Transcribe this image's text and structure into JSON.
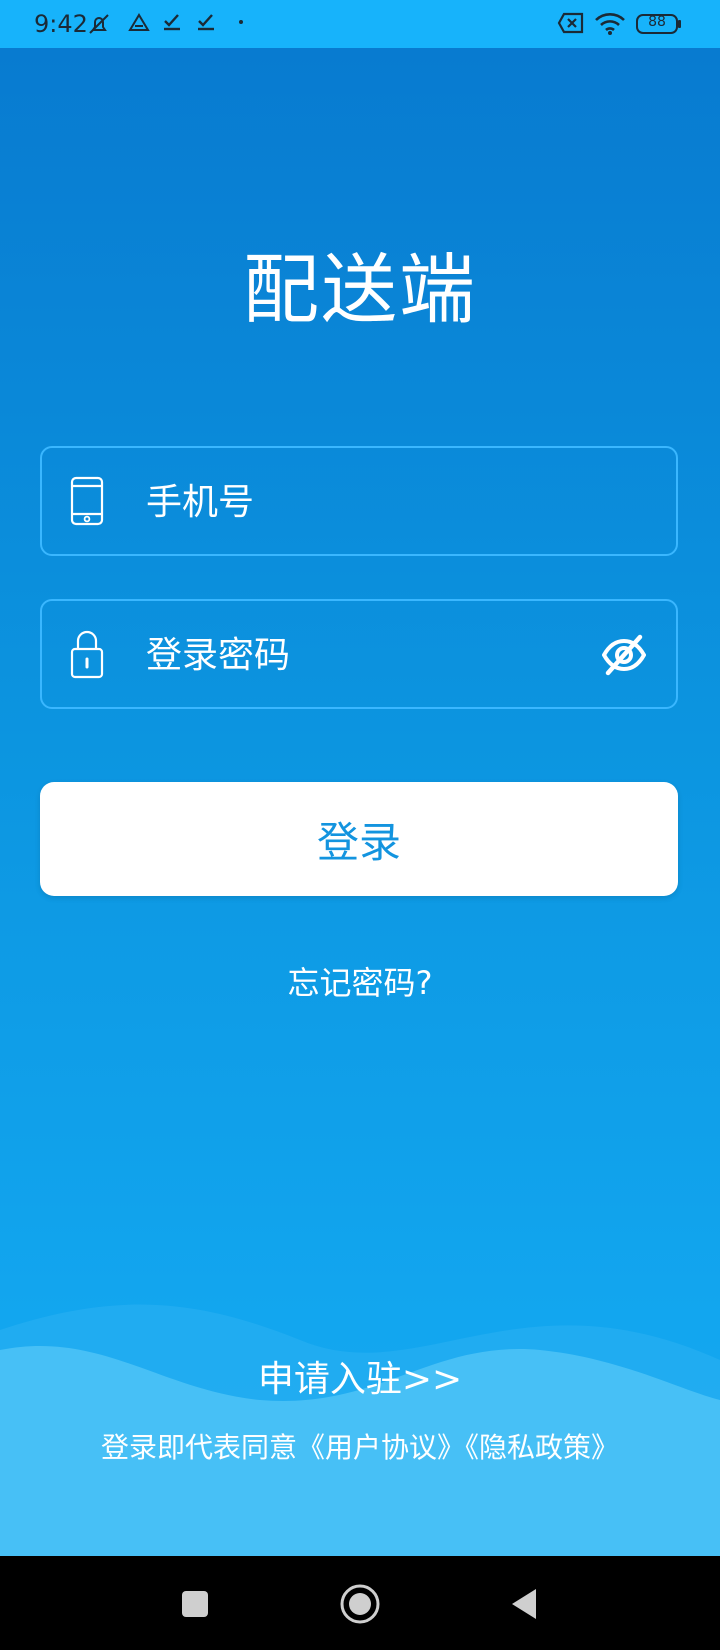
{
  "status_bar": {
    "time": "9:42",
    "battery_level": "88",
    "icons": [
      "notifications-muted-icon",
      "drive-icon",
      "checkmark-icon",
      "checkmark-icon",
      "dot-icon",
      "sim-off-icon",
      "wifi-icon",
      "battery-icon"
    ]
  },
  "app": {
    "title": "配送端"
  },
  "form": {
    "phone_placeholder": "手机号",
    "password_placeholder": "登录密码",
    "login_label": "登录",
    "forgot_label": "忘记密码?"
  },
  "footer": {
    "apply_label": "申请入驻>>",
    "agreement_prefix": "登录即代表同意",
    "user_agreement_label": "《用户协议》",
    "privacy_policy_label": "《隐私政策》"
  },
  "colors": {
    "background_top": "#0879cf",
    "background_bottom": "#12a6ef",
    "status_bar": "#17b3fb",
    "accent": "#1394df",
    "input_border": "#3ab7ff"
  }
}
